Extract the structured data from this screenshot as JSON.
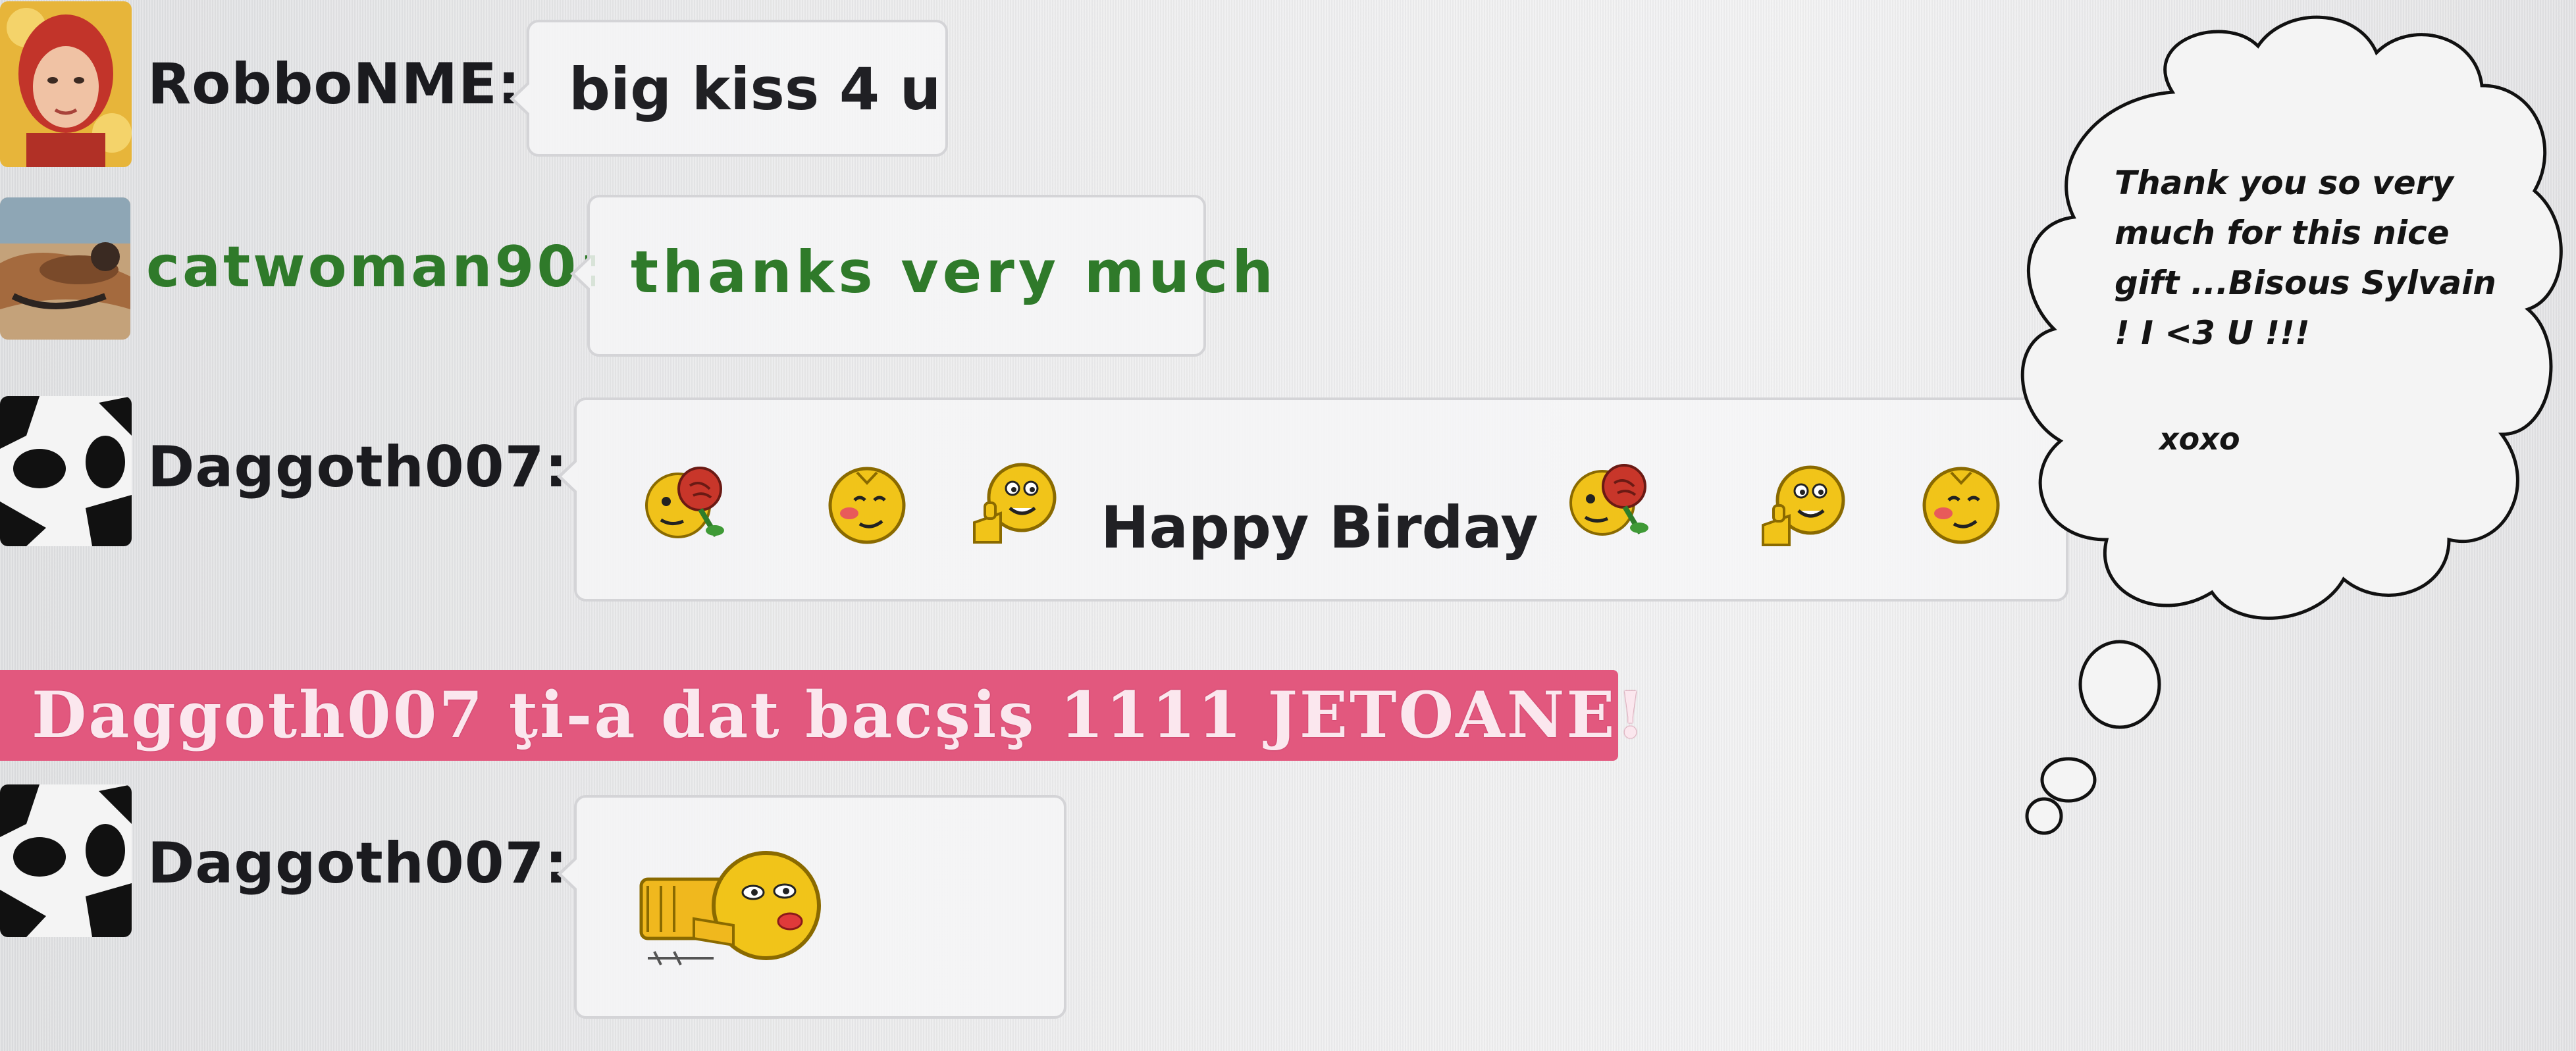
{
  "messages": [
    {
      "username": "RobboNME:",
      "text": "big kiss 4 u",
      "avatar": "red-haired-woman-avatar"
    },
    {
      "username": "catwoman90:",
      "text": "thanks very much",
      "avatar": "beach-photo-avatar"
    },
    {
      "username": "Daggoth007:",
      "text": "Happy Birday",
      "avatar": "panda-avatar",
      "emoticons_before": [
        "rose-smiley-icon",
        "blush-smiley-icon",
        "thumbs-up-smiley-icon"
      ],
      "emoticons_after": [
        "rose-smiley-icon",
        "thumbs-up-smiley-icon",
        "blush-smiley-icon"
      ]
    },
    {
      "username": "Daggoth007:",
      "avatar": "panda-avatar",
      "emoticons": [
        "kiss-smiley-icon"
      ]
    }
  ],
  "tip_banner": {
    "text": "Daggoth007 ţi-a dat bacşiş 1111 JETOANE!"
  },
  "thought_cloud": {
    "text": "Thank you so very much for this nice gift ...Bisous Sylvain ! I <3 U !!!",
    "sign": "xoxo"
  },
  "colors": {
    "username_default": "#1b1b1f",
    "username_highlight": "#2f7a2a",
    "tip_banner_bg": "#e2587e",
    "tip_banner_text": "#fbe7ee"
  }
}
